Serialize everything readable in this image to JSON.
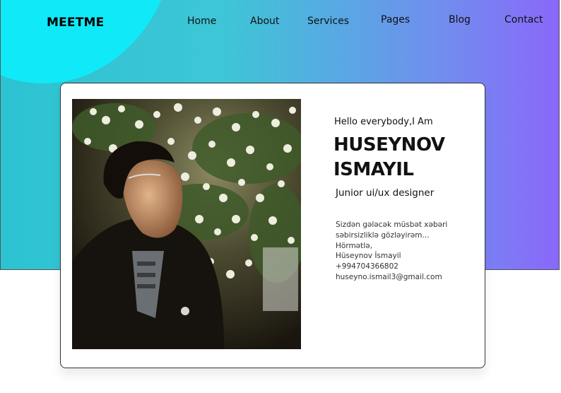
{
  "brand": {
    "logo": "MEETME"
  },
  "nav": {
    "items": [
      "Home",
      "About",
      "Services",
      "Pages",
      "Blog",
      "Contact"
    ]
  },
  "hero": {
    "greeting": "Hello everybody,I Am",
    "name_line1": "HUSEYNOV",
    "name_line2": "ISMAYIL",
    "role": "Junior ui/ux designer",
    "message_lines": [
      "Sizdən gələcək müsbət xəbəri",
      "səbirsizliklə gözləyirəm...",
      "Hörmətlə,",
      "Hüseynov İsmayil",
      "+994704366802",
      "huseyno.ismail3@gmail.com"
    ]
  },
  "colors": {
    "gradient_start": "#2cc3d2",
    "gradient_end": "#8a68fa",
    "blob": "#10eaf8"
  },
  "photo": {
    "icon": "profile-photo"
  }
}
